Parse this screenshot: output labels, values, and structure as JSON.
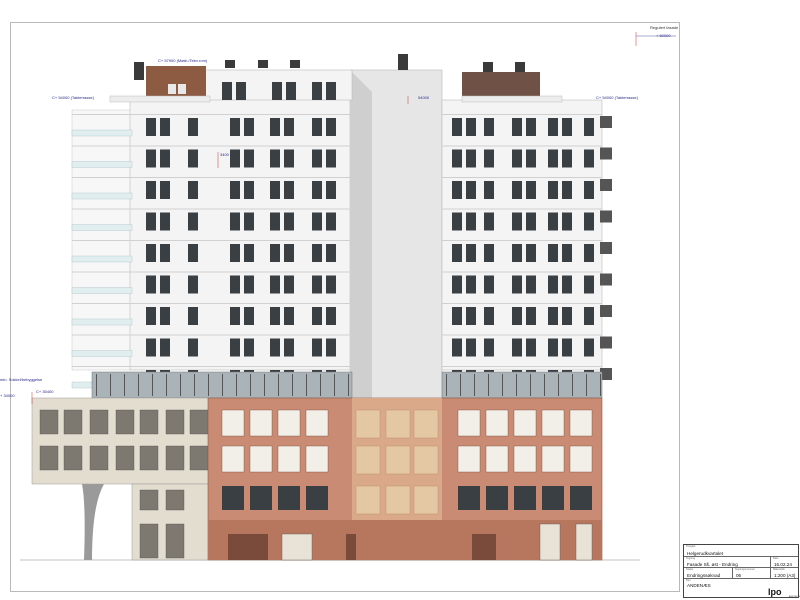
{
  "drawing": {
    "top_right_note": "Regulert fasade",
    "annotations": {
      "top_level": "+ 60000",
      "roof_left": "C+ 57900 (Møte-/Tekn.rom)",
      "terrace_left": "C+ 54000 (Takterrasse)",
      "terrace_right": "C+ 54000 (Takterrasse)",
      "upper_mid": "54000",
      "mid_dim": "3400",
      "podium_left": "C+ 35400",
      "podium_side": "min. Sokkel/bebyggelse",
      "podium_level": "+ 34000"
    }
  },
  "title_block": {
    "project_label": "Prosjekt",
    "project": "Helgerudkvartalet",
    "drawing_label": "Tegning",
    "drawing": "Fasade Sš. øst - Endring",
    "date_label": "Dato",
    "date": "16.02.24",
    "status_label": "Status",
    "status": "Endringssøknad",
    "number_label": "Tegningsnummer",
    "number": "06",
    "scale_label": "Målestokk",
    "scale": "1:200 (A3)",
    "revision_label": "Rev",
    "changes": "ANDENÆS",
    "logo": "lpo",
    "logo_sub": "ARKITEKTER"
  },
  "colors": {
    "tower": "#f4f4f4",
    "tower_shadow": "#d9d9d9",
    "window": "#3a3f44",
    "brick": "#c98b73",
    "brick_dark": "#a86a55",
    "stone": "#e3ddd0",
    "glass_band": "#aab4b8"
  }
}
